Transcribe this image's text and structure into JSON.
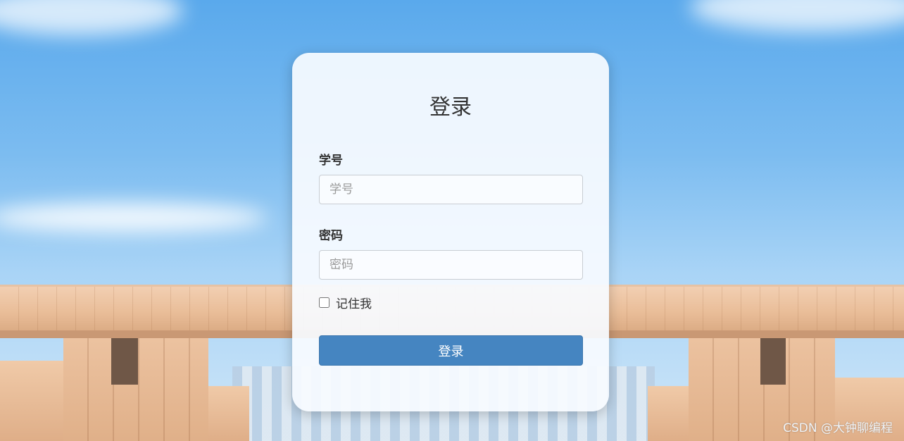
{
  "login": {
    "title": "登录",
    "student_id_label": "学号",
    "student_id_placeholder": "学号",
    "password_label": "密码",
    "password_placeholder": "密码",
    "remember_label": "记住我",
    "remember_checked": false,
    "submit_label": "登录"
  },
  "watermark": "CSDN @大钟聊编程",
  "colors": {
    "primary_button": "#4585c1",
    "card_background": "#f8fbff"
  }
}
